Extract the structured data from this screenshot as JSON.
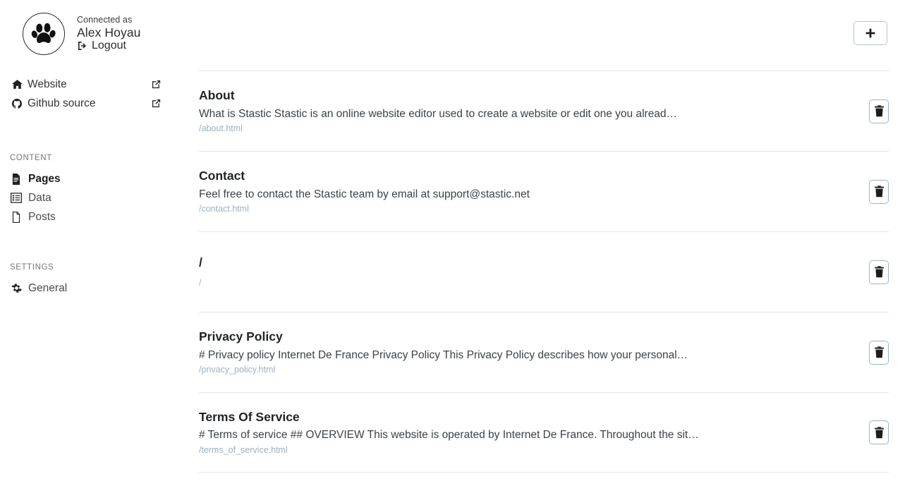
{
  "sidebar": {
    "profile": {
      "connected_label": "Connected as",
      "user_name": "Alex Hoyau",
      "logout_label": "Logout",
      "avatar_icon": "paw-logo"
    },
    "links": [
      {
        "label": "Website",
        "icon": "home-icon",
        "action_icon": "external-link-icon"
      },
      {
        "label": "Github source",
        "icon": "github-icon",
        "action_icon": "external-link-icon"
      }
    ],
    "content_section": {
      "label": "CONTENT",
      "items": [
        {
          "label": "Pages",
          "icon": "file-lines-icon",
          "active": true
        },
        {
          "label": "Data",
          "icon": "table-list-icon",
          "active": false
        },
        {
          "label": "Posts",
          "icon": "file-blank-icon",
          "active": false
        }
      ]
    },
    "settings_section": {
      "label": "SETTINGS",
      "items": [
        {
          "label": "General",
          "icon": "gear-icon",
          "active": false
        }
      ]
    }
  },
  "main": {
    "add_button_label": "+",
    "delete_button_icon": "trash-icon",
    "pages": [
      {
        "title": "About",
        "description": "What is Stastic Stastic is an online website editor used to create a website or edit one you alread…",
        "path": "/about.html"
      },
      {
        "title": "Contact",
        "description": "Feel free to contact the Stastic team by email at support@stastic.net",
        "path": "/contact.html"
      },
      {
        "title": "/",
        "description": "",
        "path": "/"
      },
      {
        "title": "Privacy Policy",
        "description": "# Privacy policy Internet De France Privacy Policy This Privacy Policy describes how your personal…",
        "path": "/privacy_policy.html"
      },
      {
        "title": "Terms Of Service",
        "description": "# Terms of service ## OVERVIEW This website is operated by Internet De France. Throughout the sit…",
        "path": "/terms_of_service.html"
      }
    ]
  },
  "colors": {
    "text_primary": "#1f2326",
    "text_secondary": "#3c4247",
    "path_muted": "#9fb0bd",
    "divider": "#e3e5e7",
    "button_border": "#9fb4c0"
  }
}
